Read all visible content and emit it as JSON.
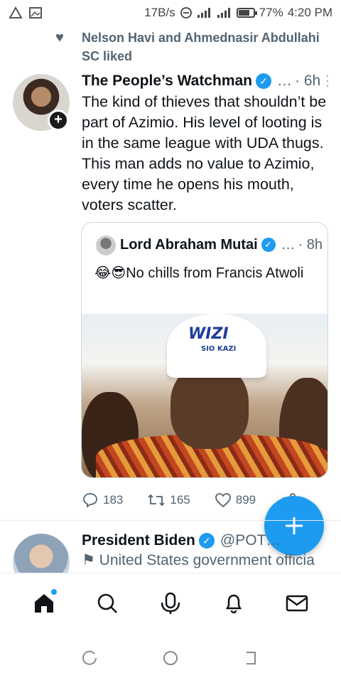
{
  "status_bar": {
    "speed": "17B/s",
    "battery": "77%",
    "battery_level": 0.77,
    "time": "4:20 PM"
  },
  "liked_banner": {
    "text": "Nelson Havi and Ahmednasir Abdullahi SC liked"
  },
  "tweet1": {
    "name": "The People’s Watchman",
    "handle": "…",
    "time": "· 6h",
    "text": "The kind of thieves that shouldn’t be part of Azimio. His level of looting is in the same league with UDA thugs. This man adds no value to Azimio, every time he opens his mouth, voters scatter.",
    "quote": {
      "name": "Lord Abraham Mutai",
      "handle": "…",
      "time": "· 8h",
      "emoji": "😂😎",
      "text": "No chills from Francis Atwoli",
      "image_cap_text": "WIZI",
      "image_cap_sub": "SIO KAZI"
    },
    "actions": {
      "replies": "183",
      "retweets": "165",
      "likes": "899"
    }
  },
  "tweet2": {
    "name": "President Biden",
    "handle": "@POT…",
    "label": "United States government officia"
  },
  "colors": {
    "accent": "#1d9bf0",
    "text": "#0f1419",
    "muted": "#536471"
  }
}
